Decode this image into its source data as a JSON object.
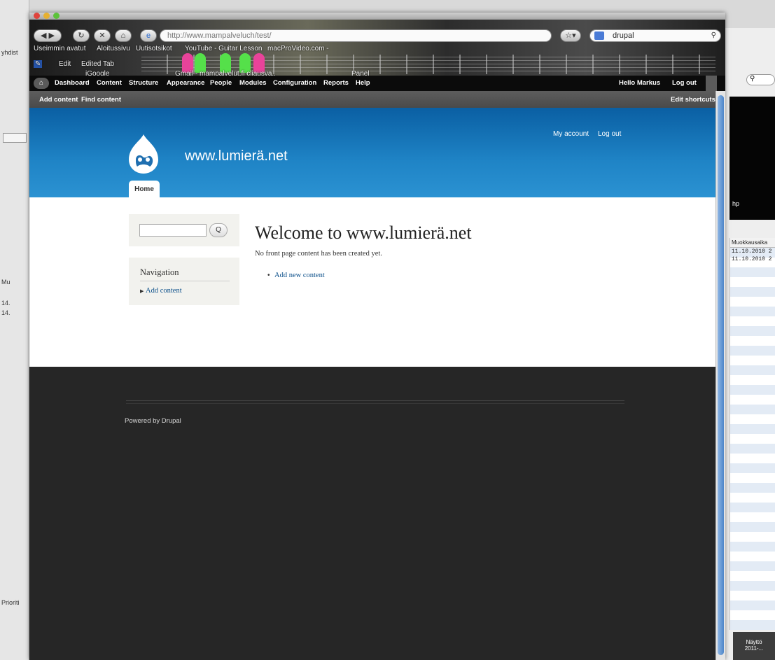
{
  "browser": {
    "url": "http://www.mampalveluch/test/",
    "search_value": "drupal",
    "search_engine": "Google",
    "bookmarks": [
      "Useimmin avatut",
      "Aloitussivu",
      "Uutisotsikot",
      "YouTube - Guitar Lesson",
      "macProVideo.com -"
    ],
    "tabs": [
      "Edit",
      "Edited Tab",
      "iGoogle",
      "Gmail - mampalvelut.fi cliausva..",
      "Panel"
    ]
  },
  "admin_toolbar": {
    "items": [
      "Dashboard",
      "Content",
      "Structure",
      "Appearance",
      "People",
      "Modules",
      "Configuration",
      "Reports",
      "Help"
    ],
    "greeting": "Hello Markus",
    "logout": "Log out"
  },
  "shortcuts": {
    "add_content": "Add content",
    "find_content": "Find content",
    "edit_shortcuts": "Edit shortcuts"
  },
  "site": {
    "name": "www.lumierä.net",
    "my_account": "My account",
    "log_out": "Log out",
    "home_tab": "Home"
  },
  "sidebar": {
    "search_button": "Q",
    "navigation_title": "Navigation",
    "navigation_link": "Add content"
  },
  "main": {
    "title": "Welcome to www.lumierä.net",
    "message": "No front page content has been created yet.",
    "link": "Add new content"
  },
  "footer": {
    "powered_by": "Powered by Drupal"
  },
  "background_windows": {
    "left_fragments": [
      "yhdist",
      "Mu",
      "14.",
      "14.",
      "Prioriti"
    ],
    "right_header": "Muokkausaika",
    "right_dates": [
      "11.10.2010 2",
      "11.10.2010 2"
    ],
    "right_label": "hp",
    "right_corner": [
      "Näyttö",
      "2011-..."
    ]
  },
  "colors": {
    "header_blue": "#1f84c6",
    "footer_bg": "#262626",
    "toolbar_bg": "#0b0b0b",
    "link": "#0b4f8a"
  }
}
